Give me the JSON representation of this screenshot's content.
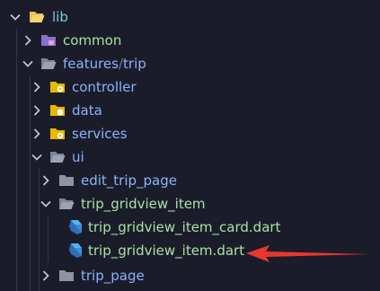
{
  "explorer": {
    "items": [
      {
        "label": "lib",
        "expanded": true,
        "icon": "folder-open-icon",
        "color": "#7ec8e3"
      },
      {
        "label": "common",
        "expanded": false,
        "icon": "folder-icon",
        "color": "#a6e3a1"
      },
      {
        "label": "features",
        "label_sep": "/",
        "label_2": "trip",
        "expanded": true,
        "icon": "folder-open-icon",
        "color": "#89b4fa"
      },
      {
        "label": "controller",
        "expanded": false,
        "icon": "gear-folder-icon",
        "color": "#89b4fa"
      },
      {
        "label": "data",
        "expanded": false,
        "icon": "data-folder-icon",
        "color": "#89b4fa"
      },
      {
        "label": "services",
        "expanded": false,
        "icon": "gear-folder-icon",
        "color": "#89b4fa"
      },
      {
        "label": "ui",
        "expanded": true,
        "icon": "folder-open-icon",
        "color": "#89b4fa"
      },
      {
        "label": "edit_trip_page",
        "expanded": false,
        "icon": "folder-icon",
        "color": "#89b4fa"
      },
      {
        "label": "trip_gridview_item",
        "expanded": true,
        "icon": "folder-open-icon",
        "color": "#a6e3a1"
      },
      {
        "label": "trip_gridview_item_card.dart",
        "icon": "dart-file-icon",
        "color": "#a6e3a1"
      },
      {
        "label": "trip_gridview_item.dart",
        "icon": "dart-file-icon",
        "color": "#a6e3a1"
      },
      {
        "label": "trip_page",
        "expanded": false,
        "icon": "folder-icon",
        "color": "#89b4fa"
      }
    ]
  },
  "colors": {
    "background": "#1b1c2a",
    "arrow": "#e8382e",
    "dart": "#4fa5e8"
  }
}
